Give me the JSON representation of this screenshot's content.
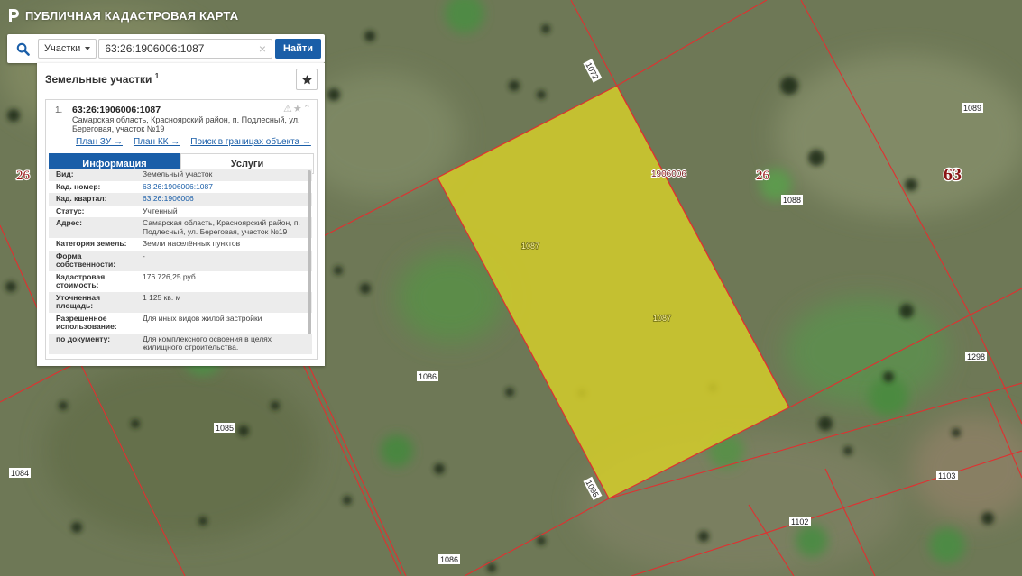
{
  "app": {
    "title": "ПУБЛИЧНАЯ КАДАСТРОВАЯ КАРТА"
  },
  "search": {
    "type_label": "Участки",
    "value": "63:26:1906006:1087",
    "button_label": "Найти"
  },
  "panel": {
    "title": "Земельные участки",
    "count": "1"
  },
  "result": {
    "index": "1.",
    "number": "63:26:1906006:1087",
    "address": "Самарская область, Красноярский район, п. Подлесный, ул. Береговая, участок №19",
    "links": [
      "План ЗУ →",
      "План КК →",
      "Поиск в границах объекта →"
    ]
  },
  "tabs": [
    "Информация",
    "Услуги"
  ],
  "properties": [
    {
      "key": "Вид:",
      "value": "Земельный участок",
      "link": false
    },
    {
      "key": "Кад. номер:",
      "value": "63:26:1906006:1087",
      "link": true
    },
    {
      "key": "Кад. квартал:",
      "value": "63:26:1906006",
      "link": true
    },
    {
      "key": "Статус:",
      "value": "Учтенный",
      "link": false
    },
    {
      "key": "Адрес:",
      "value": "Самарская область, Красноярский район, п. Подлесный, ул. Береговая, участок №19",
      "link": false
    },
    {
      "key": "Категория земель:",
      "value": "Земли населённых пунктов",
      "link": false
    },
    {
      "key": "Форма собственности:",
      "value": "-",
      "link": false
    },
    {
      "key": "Кадастровая стоимость:",
      "value": "176 726,25 руб.",
      "link": false
    },
    {
      "key": "Уточненная площадь:",
      "value": "1 125 кв. м",
      "link": false
    },
    {
      "key": "Разрешенное использование:",
      "value": "Для иных видов жилой застройки",
      "link": false
    },
    {
      "key": "по документу:",
      "value": "Для комплексного освоения в целях жилищного строительства.",
      "link": false
    }
  ],
  "map_labels": {
    "big_region": "63",
    "district_left": "26",
    "district_mid": "26",
    "quarter": "1906006",
    "parcels": [
      "1087",
      "1087",
      "1072",
      "1089",
      "1088",
      "1086",
      "1085",
      "1084",
      "1298",
      "1103",
      "1102",
      "1086",
      "1095"
    ]
  },
  "colors": {
    "accent": "#1a5ea8",
    "parcel_fill": "#d4cc2a",
    "boundary": "#e03030"
  }
}
